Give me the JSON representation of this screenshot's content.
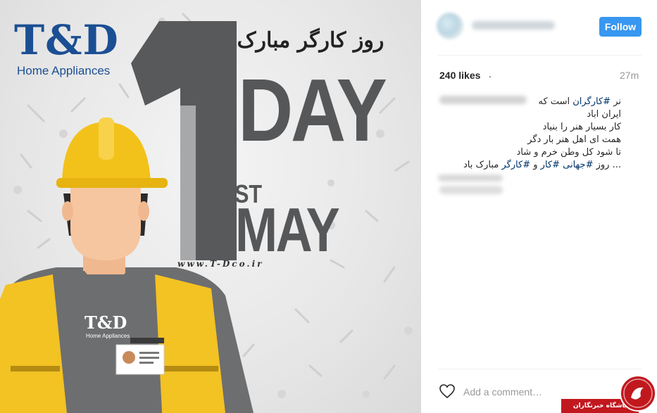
{
  "post_image": {
    "logo": "T&D",
    "logo_subtitle": "Home Appliances",
    "persian_title": "روز کارگر مبارک",
    "big_numeral": "1",
    "day_text": "DAY",
    "ordinal_suffix": "ST",
    "month_text": "MAY",
    "website": "www.T-Dco.ir",
    "shirt_logo": "T&D",
    "shirt_logo_subtitle": "Home Appliances",
    "colors": {
      "brand_blue": "#1b4f93",
      "helmet_yellow": "#f2c21b",
      "vest_yellow": "#f3c223",
      "shirt_gray": "#6d6e70",
      "text_gray": "#555759",
      "skin": "#f6c6a0",
      "hair": "#2b2b2b"
    }
  },
  "panel": {
    "follow_label": "Follow",
    "likes": "240 likes",
    "likes_trailing": ".",
    "time_ago": "27m",
    "caption": {
      "line1_prefix": "نر",
      "line1_hashtag": "#کارگران",
      "line1_suffix": "است که",
      "line2": "ایران اباد",
      "line3": "کار بسیار هنر را بنیاد",
      "line4": "همت ای اهل هنر بار دگر",
      "line5": "تا شود کل وطن خرم و شاد",
      "line6_prefix": "... روز",
      "line6_hashtag1": "#جهانی",
      "line6_hashtag2": "#کار",
      "line6_and": "و",
      "line6_hashtag3": "#کارگر",
      "line6_suffix": "مبارک باد"
    },
    "comment_placeholder": "Add a comment…",
    "icons": {
      "like": "heart-icon"
    },
    "colors": {
      "follow_blue": "#3897f0",
      "hashtag": "#003569",
      "muted": "#999999"
    }
  },
  "watermark": {
    "label": "باشگاه خبرنگاران",
    "color": "#c1181e"
  }
}
